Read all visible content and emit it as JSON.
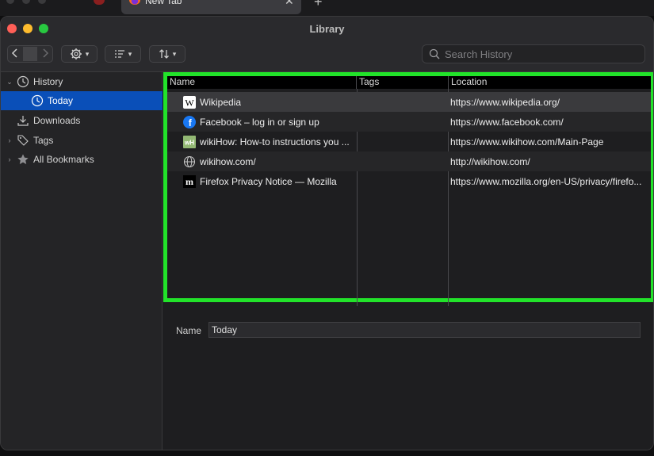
{
  "browser": {
    "active_tab_title": "New Tab"
  },
  "window": {
    "title": "Library"
  },
  "toolbar": {
    "search_placeholder": "Search History"
  },
  "sidebar": {
    "items": [
      {
        "label": "History",
        "icon": "clock-icon",
        "expanded": true
      },
      {
        "label": "Today",
        "icon": "clock-icon",
        "selected": true
      },
      {
        "label": "Downloads",
        "icon": "download-icon"
      },
      {
        "label": "Tags",
        "icon": "tags-icon",
        "expanded": false
      },
      {
        "label": "All Bookmarks",
        "icon": "star-icon",
        "expanded": false
      }
    ]
  },
  "table": {
    "columns": [
      "Name",
      "Tags",
      "Location"
    ],
    "rows": [
      {
        "name": "Wikipedia",
        "tags": "",
        "location": "https://www.wikipedia.org/",
        "icon": "wikipedia-favicon"
      },
      {
        "name": "Facebook – log in or sign up",
        "tags": "",
        "location": "https://www.facebook.com/",
        "icon": "facebook-favicon"
      },
      {
        "name": "wikiHow: How-to instructions you ...",
        "tags": "",
        "location": "https://www.wikihow.com/Main-Page",
        "icon": "wikihow-favicon"
      },
      {
        "name": "wikihow.com/",
        "tags": "",
        "location": "http://wikihow.com/",
        "icon": "globe-icon"
      },
      {
        "name": "Firefox Privacy Notice — Mozilla",
        "tags": "",
        "location": "https://www.mozilla.org/en-US/privacy/firefo...",
        "icon": "mozilla-favicon"
      }
    ]
  },
  "details": {
    "name_label": "Name",
    "name_value": "Today"
  },
  "colors": {
    "highlight_border": "#22e32a",
    "selection": "#0a4fb8"
  }
}
